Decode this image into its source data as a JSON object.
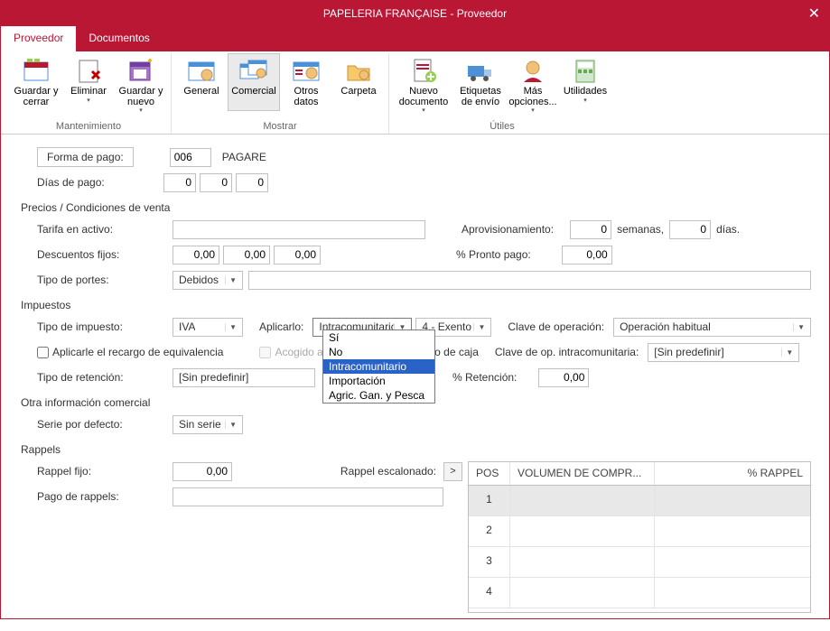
{
  "window": {
    "title": "PAPELERIA FRANÇAISE - Proveedor"
  },
  "tabs": {
    "active": "Proveedor",
    "other": "Documentos"
  },
  "ribbon": {
    "maintenance_label": "Mantenimiento",
    "show_label": "Mostrar",
    "utils_label": "Útiles",
    "btns": {
      "save_close": "Guardar y cerrar",
      "delete": "Eliminar",
      "save_new": "Guardar y nuevo",
      "general": "General",
      "commercial": "Comercial",
      "other_data": "Otros datos",
      "folder": "Carpeta",
      "new_doc": "Nuevo documento",
      "ship_labels": "Etiquetas de envío",
      "more_opts": "Más opciones...",
      "utilities": "Utilidades"
    }
  },
  "form": {
    "payment_method_label": "Forma de pago:",
    "payment_method_code": "006",
    "payment_method_name": "PAGARE",
    "pay_days_label": "Días de pago:",
    "pay_days": [
      "0",
      "0",
      "0"
    ],
    "prices_section": "Precios / Condiciones de venta",
    "tariff_label": "Tarifa en activo:",
    "tariff_value": "",
    "supply_label": "Aprovisionamiento:",
    "supply_weeks": "0",
    "weeks_suffix": "semanas,",
    "supply_days": "0",
    "days_suffix": "días.",
    "fixed_disc_label": "Descuentos fijos:",
    "fixed_disc": [
      "0,00",
      "0,00",
      "0,00"
    ],
    "prompt_pay_label": "% Pronto pago:",
    "prompt_pay_value": "0,00",
    "freight_label": "Tipo de portes:",
    "freight_value": "Debidos",
    "freight_text": "",
    "tax_section": "Impuestos",
    "tax_type_label": "Tipo de impuesto:",
    "tax_type_value": "IVA",
    "apply_label": "Aplicarlo:",
    "apply_value": "Intracomunitario",
    "apply_options": [
      "Sí",
      "No",
      "Intracomunitario",
      "Importación",
      "Agric. Gan. y Pesca"
    ],
    "apply_selected_idx": 2,
    "exempt_value": "4.- Exento",
    "op_key_label": "Clave de operación:",
    "op_key_value": "Operación habitual",
    "equiv_chk_label": "Aplicarle el recargo de equivalencia",
    "cash_crit_label_partial": "Acogido a",
    "cash_crit_label_rest": "riterio de caja",
    "intra_key_label": "Clave de op. intracomunitaria:",
    "intra_key_value": "[Sin predefinir]",
    "ret_type_label": "Tipo de retención:",
    "ret_type_value": "[Sin predefinir]",
    "ret_pct_label": "% Retención:",
    "ret_pct_value": "0,00",
    "other_info_section": "Otra información comercial",
    "series_label": "Serie por defecto:",
    "series_value": "Sin serie",
    "rappels_section": "Rappels",
    "fixed_rappel_label": "Rappel fijo:",
    "fixed_rappel_value": "0,00",
    "rappel_step_label": "Rappel escalonado:",
    "rappel_pay_label": "Pago de rappels:",
    "rappel_pay_value": "",
    "rappel_table": {
      "headers": {
        "pos": "POS",
        "vol": "VOLUMEN DE COMPR...",
        "pct": "% RAPPEL"
      },
      "rows": [
        "1",
        "2",
        "3",
        "4"
      ]
    }
  }
}
